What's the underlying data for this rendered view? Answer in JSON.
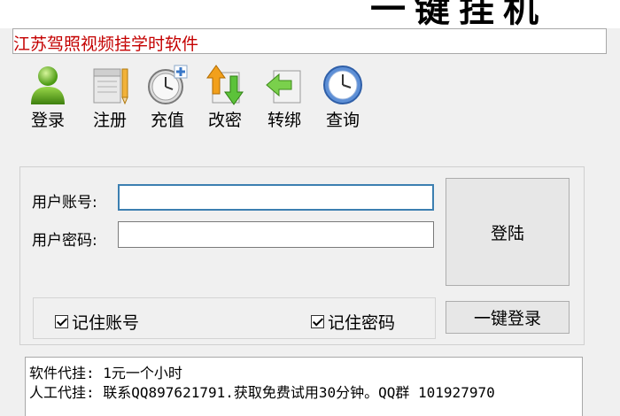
{
  "banner": {
    "title": "一键挂机"
  },
  "subtitle": "江苏驾照视频挂学时软件",
  "toolbar": {
    "items": [
      {
        "label": "登录",
        "icon": "user-icon"
      },
      {
        "label": "注册",
        "icon": "notepad-pencil-icon"
      },
      {
        "label": "充值",
        "icon": "clock-plus-icon"
      },
      {
        "label": "改密",
        "icon": "arrows-updown-icon"
      },
      {
        "label": "转绑",
        "icon": "arrow-left-page-icon"
      },
      {
        "label": "查询",
        "icon": "clock-icon"
      }
    ]
  },
  "login": {
    "account_label": "用户账号:",
    "password_label": "用户密码:",
    "account_value": "",
    "password_value": "",
    "login_button": "登陆",
    "remember_account": "记住账号",
    "remember_password": "记住密码",
    "onekey_button": "一键登录"
  },
  "info": {
    "line1": "软件代挂: 1元一个小时",
    "line2": "人工代挂: 联系QQ897621791.获取免费试用30分钟。QQ群 101927970"
  },
  "colors": {
    "subtitle": "#c40000",
    "focus_border": "#3c7fb1",
    "background": "#f0f0f0"
  }
}
